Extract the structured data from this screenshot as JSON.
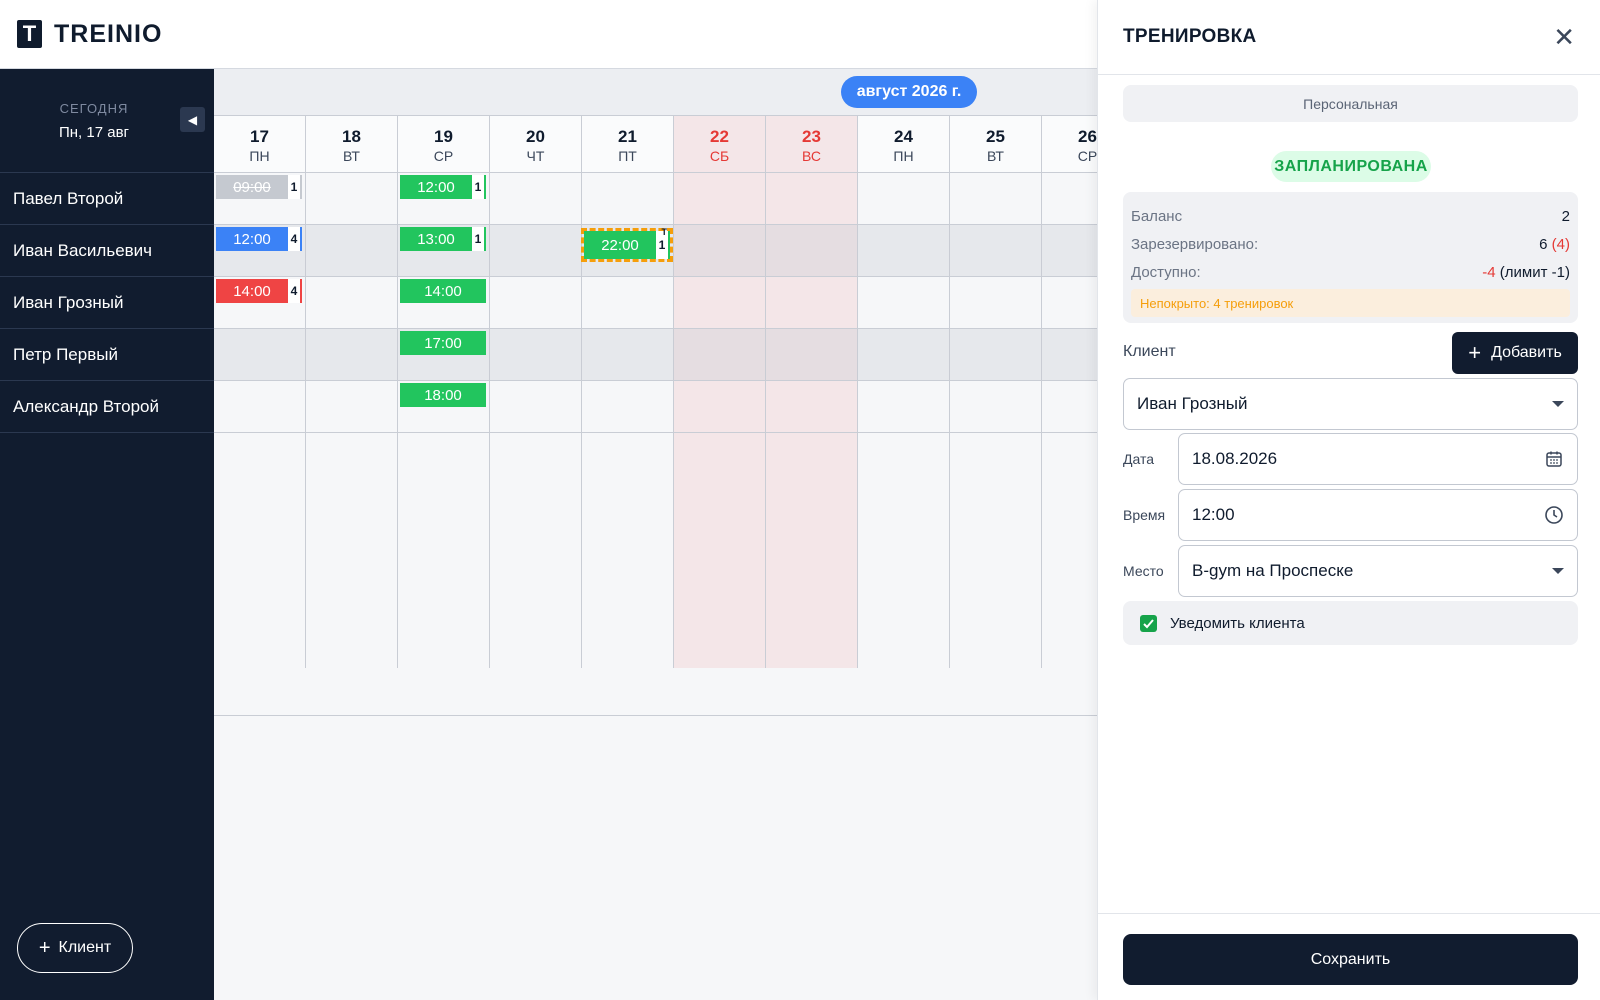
{
  "app": {
    "logo_letter": "T",
    "logo_text": "TREINIO"
  },
  "sidebar": {
    "today_label": "СЕГОДНЯ",
    "today_date": "Пн, 17 авг",
    "clients": [
      "Павел Второй",
      "Иван Васильевич",
      "Иван Грозный",
      "Петр Первый",
      "Александр Второй"
    ],
    "add_client_label": "Клиент"
  },
  "calendar": {
    "month_label": "август 2026 г.",
    "days": [
      {
        "num": "17",
        "name": "ПН",
        "weekend": false
      },
      {
        "num": "18",
        "name": "ВТ",
        "weekend": false
      },
      {
        "num": "19",
        "name": "СР",
        "weekend": false
      },
      {
        "num": "20",
        "name": "ЧТ",
        "weekend": false
      },
      {
        "num": "21",
        "name": "ПТ",
        "weekend": false
      },
      {
        "num": "22",
        "name": "СБ",
        "weekend": true
      },
      {
        "num": "23",
        "name": "ВС",
        "weekend": true
      },
      {
        "num": "24",
        "name": "ПН",
        "weekend": false
      },
      {
        "num": "25",
        "name": "ВТ",
        "weekend": false
      },
      {
        "num": "26",
        "name": "СР",
        "weekend": false
      }
    ],
    "events": [
      {
        "day": 0,
        "row": 0,
        "time": "09:00",
        "count": "1",
        "color": "gray"
      },
      {
        "day": 2,
        "row": 0,
        "time": "12:00",
        "count": "1",
        "color": "green"
      },
      {
        "day": 0,
        "row": 1,
        "time": "12:00",
        "count": "4",
        "color": "blue"
      },
      {
        "day": 2,
        "row": 1,
        "time": "13:00",
        "count": "1",
        "color": "green"
      },
      {
        "day": 4,
        "row": 1,
        "time": "22:00",
        "count": "1",
        "color": "green",
        "selected": true,
        "mark": "T"
      },
      {
        "day": 0,
        "row": 2,
        "time": "14:00",
        "count": "4",
        "color": "red"
      },
      {
        "day": 2,
        "row": 2,
        "time": "14:00",
        "count": "",
        "color": "green"
      },
      {
        "day": 2,
        "row": 3,
        "time": "17:00",
        "count": "",
        "color": "green"
      },
      {
        "day": 2,
        "row": 4,
        "time": "18:00",
        "count": "",
        "color": "green"
      }
    ]
  },
  "panel": {
    "title": "ТРЕНИРОВКА",
    "type": "Персональная",
    "status": "ЗАПЛАНИРОВАНА",
    "balance": {
      "balance_label": "Баланс",
      "balance_value": "2",
      "reserved_label": "Зарезервировано:",
      "reserved_value": "6",
      "reserved_extra": "(4)",
      "available_label": "Доступно:",
      "available_value": "-4",
      "available_limit": "(лимит -1)",
      "uncovered": "Непокрыто: 4 тренировок"
    },
    "client_label": "Клиент",
    "add_label": "Добавить",
    "client_value": "Иван Грозный",
    "date_label": "Дата",
    "date_value": "18.08.2026",
    "time_label": "Время",
    "time_value": "12:00",
    "place_label": "Место",
    "place_value": "B-gym на Проспеске",
    "notify_label": "Уведомить клиента",
    "save_label": "Сохранить"
  },
  "colors": {
    "green": "#22c55e",
    "blue": "#3b82f6",
    "red": "#ef4444",
    "gray": "#c5c9d0",
    "navy": "#111c2f"
  }
}
